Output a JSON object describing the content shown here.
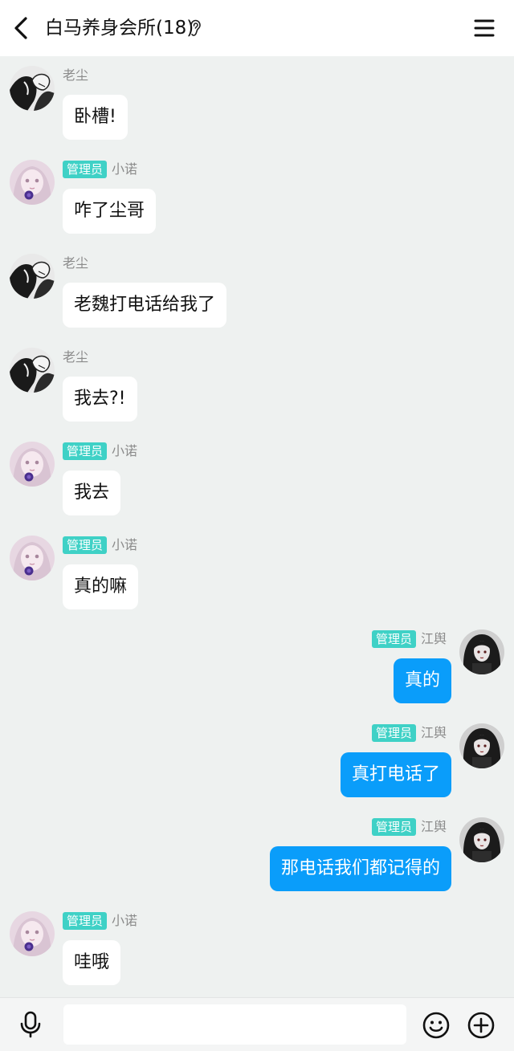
{
  "header": {
    "title": "白马养身会所(18)",
    "back_icon": "chevron-left-icon",
    "listen_icon": "ear-icon",
    "menu_icon": "hamburger-menu-icon"
  },
  "messages": [
    {
      "side": "left",
      "sender": "老尘",
      "admin_label": "",
      "text": "卧槽!",
      "avatar": "bw-manga"
    },
    {
      "side": "left",
      "sender": "小诺",
      "admin_label": "管理员",
      "text": "咋了尘哥",
      "avatar": "pastel-doll"
    },
    {
      "side": "left",
      "sender": "老尘",
      "admin_label": "",
      "text": "老魏打电话给我了",
      "avatar": "bw-manga"
    },
    {
      "side": "left",
      "sender": "老尘",
      "admin_label": "",
      "text": "我去?!",
      "avatar": "bw-manga"
    },
    {
      "side": "left",
      "sender": "小诺",
      "admin_label": "管理员",
      "text": "我去",
      "avatar": "pastel-doll"
    },
    {
      "side": "left",
      "sender": "小诺",
      "admin_label": "管理员",
      "text": "真的嘛",
      "avatar": "pastel-doll"
    },
    {
      "side": "right",
      "sender": "江舆",
      "admin_label": "管理员",
      "text": "真的",
      "avatar": "dark-gothic"
    },
    {
      "side": "right",
      "sender": "江舆",
      "admin_label": "管理员",
      "text": "真打电话了",
      "avatar": "dark-gothic"
    },
    {
      "side": "right",
      "sender": "江舆",
      "admin_label": "管理员",
      "text": "那电话我们都记得的",
      "avatar": "dark-gothic"
    },
    {
      "side": "left",
      "sender": "小诺",
      "admin_label": "管理员",
      "text": "哇哦",
      "avatar": "pastel-doll"
    }
  ],
  "input_bar": {
    "placeholder": "",
    "mic_icon": "microphone-icon",
    "emoji_icon": "smiley-icon",
    "plus_icon": "plus-circle-icon"
  },
  "colors": {
    "background": "#eef1f0",
    "bubble_self": "#0a9dfa",
    "bubble_other": "#ffffff",
    "admin_badge": "#3fd1c6"
  }
}
